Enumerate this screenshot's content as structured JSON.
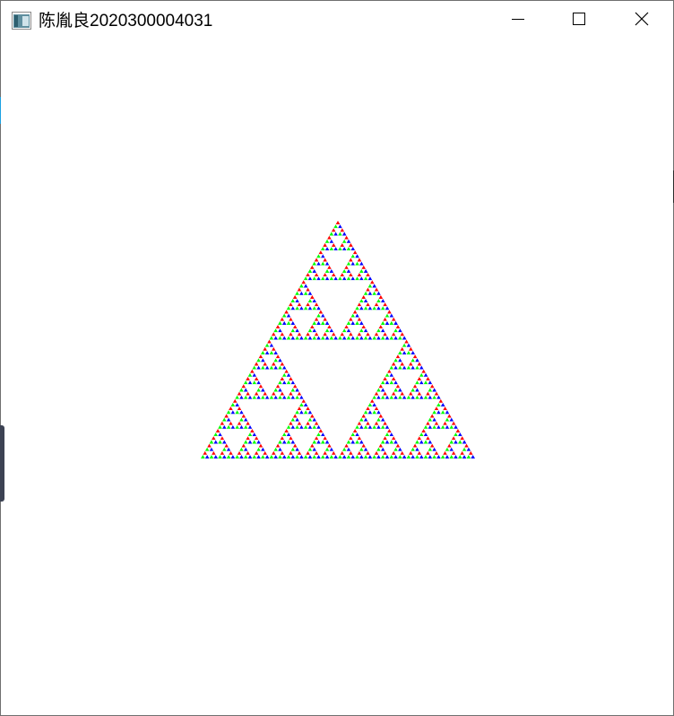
{
  "window": {
    "title": "陈胤良2020300004031",
    "app_icon": "window-app-icon",
    "buttons": {
      "minimize_icon": "minimize-icon",
      "maximize_icon": "maximize-icon",
      "close_icon": "close-icon"
    }
  },
  "canvas": {
    "content": "sierpinski-triangle",
    "depth": 6,
    "colors": [
      "#ff0000",
      "#00ff00",
      "#0000ff",
      "#ffffff"
    ]
  }
}
